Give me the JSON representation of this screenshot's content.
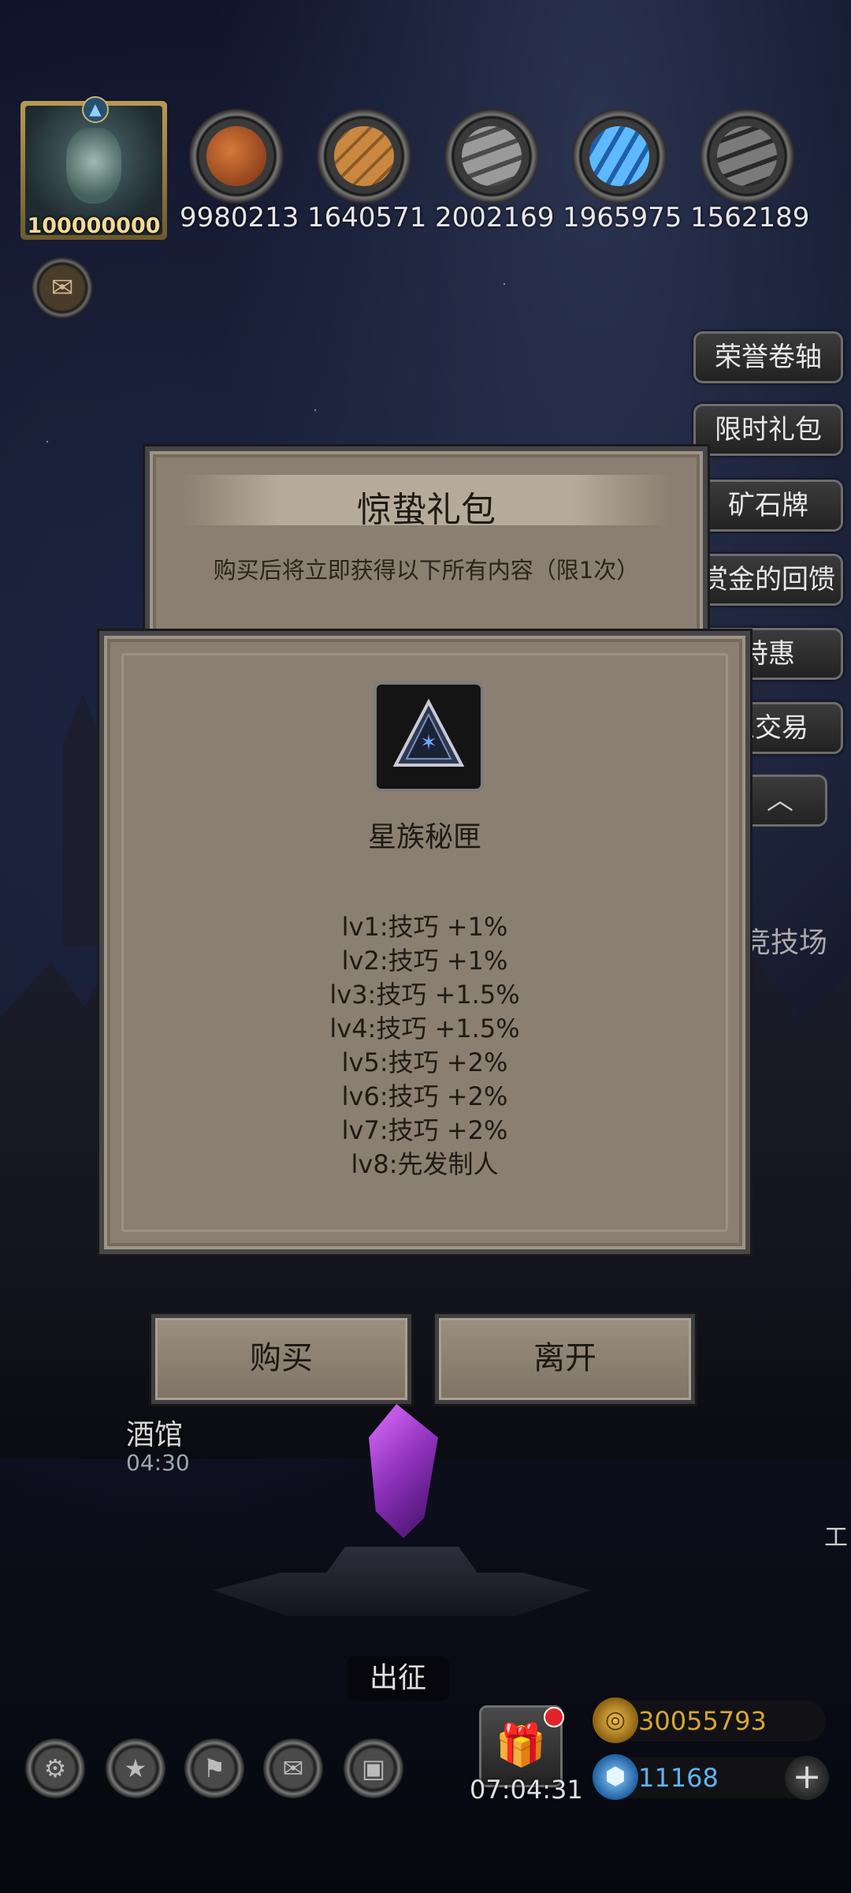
{
  "player": {
    "avatar_value": "100000000"
  },
  "resources": [
    {
      "icon": "meat-icon",
      "value": "9980213",
      "color": "#b5542a"
    },
    {
      "icon": "wood-icon",
      "value": "1640571",
      "color": "#b07a3a"
    },
    {
      "icon": "iron-icon",
      "value": "2002169",
      "color": "#8a8a8a"
    },
    {
      "icon": "crystal-icon",
      "value": "1965975",
      "color": "#3d8fd6"
    },
    {
      "icon": "steel-icon",
      "value": "1562189",
      "color": "#6a6a6a"
    }
  ],
  "side_menu": [
    "荣誉卷轴",
    "限时礼包",
    "矿石牌",
    "赏金的回馈",
    "特惠",
    "兰交易"
  ],
  "dialog": {
    "title": "惊蛰礼包",
    "subtitle": "购买后将立即获得以下所有内容（限1次）",
    "item_name": "星族秘匣",
    "levels": [
      "lv1:技巧 +1%",
      "lv2:技巧 +1%",
      "lv3:技巧 +1.5%",
      "lv4:技巧 +1.5%",
      "lv5:技巧 +2%",
      "lv6:技巧 +2%",
      "lv7:技巧 +2%",
      "lv8:先发制人"
    ],
    "buy_label": "购买",
    "leave_label": "离开"
  },
  "town": {
    "tavern_label": "酒馆",
    "tavern_time": "04:30",
    "expedition_label": "出征",
    "arena_label": "竞技场",
    "edge_label": "工"
  },
  "gift": {
    "timer": "07:04:31"
  },
  "currency": {
    "gold": "30055793",
    "gems": "11168",
    "gold_color": "#d9a634",
    "gem_color": "#5fb3f0"
  }
}
